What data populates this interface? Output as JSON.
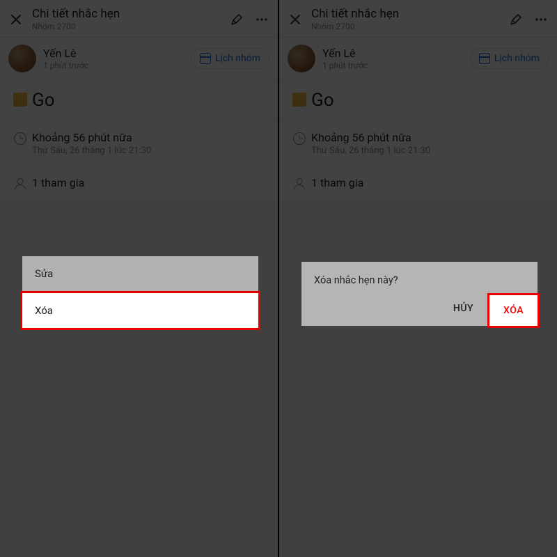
{
  "header": {
    "title": "Chi tiết nhắc hẹn",
    "subtitle": "Nhóm 2700"
  },
  "user": {
    "name": "Yến Lê",
    "time": "1 phút trước",
    "chip_label": "Lịch nhóm"
  },
  "event": {
    "title": "Go",
    "time_relative": "Khoảng 56 phút nữa",
    "time_absolute": "Thứ Sáu, 26 tháng 1 lúc 21:30",
    "participants_label": "1 tham gia"
  },
  "sheet": {
    "edit": "Sửa",
    "delete": "Xóa"
  },
  "dialog": {
    "message": "Xóa nhắc hẹn này?",
    "cancel": "HỦY",
    "confirm": "XÓA"
  }
}
